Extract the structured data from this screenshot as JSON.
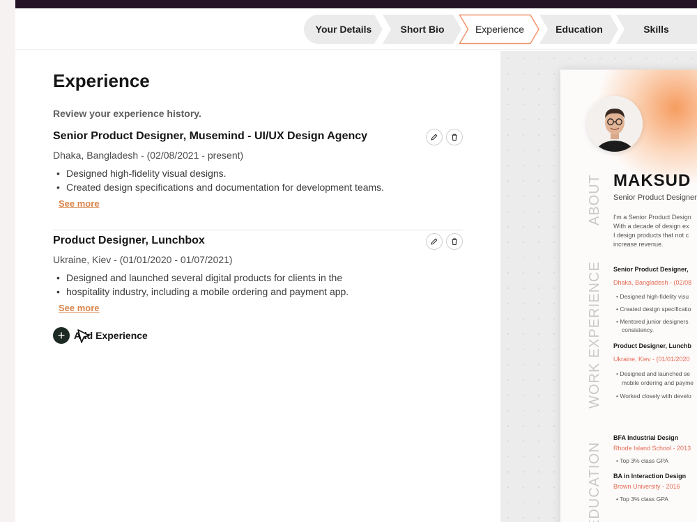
{
  "steps": [
    {
      "label": "Your Details",
      "active": false
    },
    {
      "label": "Short Bio",
      "active": false
    },
    {
      "label": "Experience",
      "active": true
    },
    {
      "label": "Education",
      "active": false
    },
    {
      "label": "Skills",
      "active": false
    }
  ],
  "form": {
    "title": "Experience",
    "subtitle": "Review your experience history.",
    "experiences": [
      {
        "title": "Senior Product Designer, Musemind - UI/UX Design Agency",
        "meta": "Dhaka, Bangladesh - (02/08/2021 - present)",
        "bullets": [
          "Designed high-fidelity visual designs.",
          "Created design specifications and documentation for development teams."
        ],
        "see_more": "See more"
      },
      {
        "title": "Product Designer, Lunchbox",
        "meta": "Ukraine, Kiev - (01/01/2020 - 01/07/2021)",
        "bullets": [
          "Designed and launched several digital products for clients in the",
          "hospitality industry, including a mobile ordering and payment app."
        ],
        "see_more": "See more"
      }
    ],
    "add_label": "Add Experience",
    "add_symbol": "+"
  },
  "resume": {
    "name": "MAKSUD",
    "role": "Senior Product Designer",
    "section_about": "ABOUT",
    "section_work": "WORK EXPERIENCE",
    "section_education": "EDUCATION",
    "about_lines": [
      "I'm a Senior Product Design",
      "With a decade of design ex",
      "I design products that not c",
      "increase revenue."
    ],
    "jobs": [
      {
        "title": "Senior Product Designer,",
        "place": "Dhaka, Bangladesh - (02/08",
        "bullets": [
          "Designed high-fidelity visu",
          "Created design specificatio",
          "Mentored junior designers",
          "consistency."
        ]
      },
      {
        "title": "Product Designer, Lunchb",
        "place": "Ukraine, Kiev - (01/01/2020",
        "bullets": [
          "Designed and launched se",
          "mobile ordering and payme",
          "Worked closely with develo"
        ]
      }
    ],
    "education": [
      {
        "degree": "BFA Industrial Design",
        "school": "Rhode Island School - 2013",
        "note": "Top 3% class GPA"
      },
      {
        "degree": "BA in Interaction Design",
        "school": "Brown University - 2016",
        "note": "Top 3% class GPA"
      }
    ]
  },
  "colors": {
    "accent": "#f0946a",
    "link": "#d9854b",
    "resume_red": "#e46b55",
    "dark": "#231325"
  }
}
